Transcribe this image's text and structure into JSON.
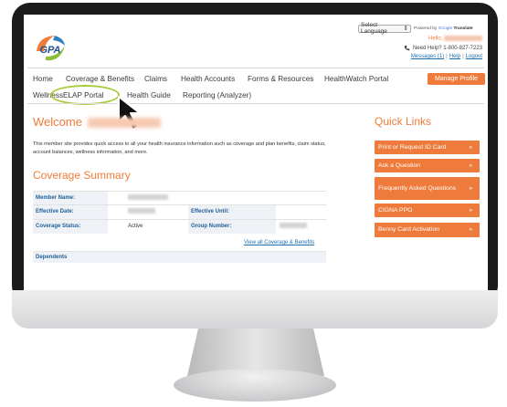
{
  "header": {
    "logo_text": "GPA",
    "language_select": "Select Language",
    "powered_by": "Powered by",
    "google": "Google",
    "translate": "Translate",
    "hello": "Hello,",
    "help_text": "Need Help? 1-800-827-7223",
    "messages": "Messages (1)",
    "help_link": "Help",
    "logout": "Logout"
  },
  "nav": {
    "row1": [
      "Home",
      "Coverage & Benefits",
      "Claims",
      "Health Accounts",
      "Forms & Resources",
      "HealthWatch Portal"
    ],
    "row2": [
      "Wellness",
      "ELAP Portal",
      "Health Guide",
      "Reporting (Analyzer)"
    ],
    "manage_profile": "Manage Profile"
  },
  "main": {
    "welcome": "Welcome",
    "intro": "This member site provides quick access to all your health insurance information such as coverage and plan benefits, claim status, account balances, wellness information, and more.",
    "coverage_title": "Coverage Summary",
    "member_name_label": "Member Name:",
    "effective_date_label": "Effective Date:",
    "effective_until_label": "Effective Until:",
    "coverage_status_label": "Coverage Status:",
    "coverage_status_value": "Active",
    "group_number_label": "Group Number:",
    "view_all": "View all Coverage & Benefits",
    "dependents": "Dependents"
  },
  "quick_links": {
    "title": "Quick Links",
    "items": [
      "Print or Request ID Card",
      "Ask a Question",
      "Frequently Asked Questions",
      "CIGNA PPO",
      "Benny Card Activation"
    ]
  },
  "colors": {
    "accent": "#ee7b3b",
    "link": "#1e6fb0",
    "label": "#1e5e97",
    "highlight": "#a8cc3a"
  }
}
